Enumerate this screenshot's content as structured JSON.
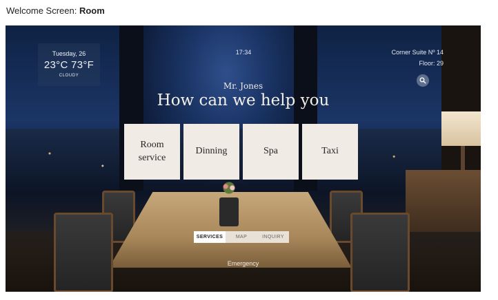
{
  "caption": {
    "prefix": "Welcome Screen: ",
    "title": "Room"
  },
  "weather": {
    "day": "Tuesday, 26",
    "temperature": "23°C 73°F",
    "condition": "CLOUDY"
  },
  "clock": {
    "time": "17:34"
  },
  "room": {
    "suite": "Corner Suite Nº 14",
    "floor": "Floor: 29"
  },
  "search": {
    "icon": "search-icon"
  },
  "greeting": {
    "guest": "Mr. Jones",
    "headline": "How can we help you"
  },
  "services": [
    {
      "label_line1": "Room",
      "label_line2": "service"
    },
    {
      "label_line1": "Dinning",
      "label_line2": ""
    },
    {
      "label_line1": "Spa",
      "label_line2": ""
    },
    {
      "label_line1": "Taxi",
      "label_line2": ""
    }
  ],
  "tabs": [
    {
      "label": "SERVICES",
      "active": true
    },
    {
      "label": "MAP",
      "active": false
    },
    {
      "label": "INQUIRY",
      "active": false
    }
  ],
  "footer": {
    "emergency": "Emergency"
  },
  "colors": {
    "card_bg": "#f0ebe4",
    "overlay_text": "#f4efe6"
  }
}
